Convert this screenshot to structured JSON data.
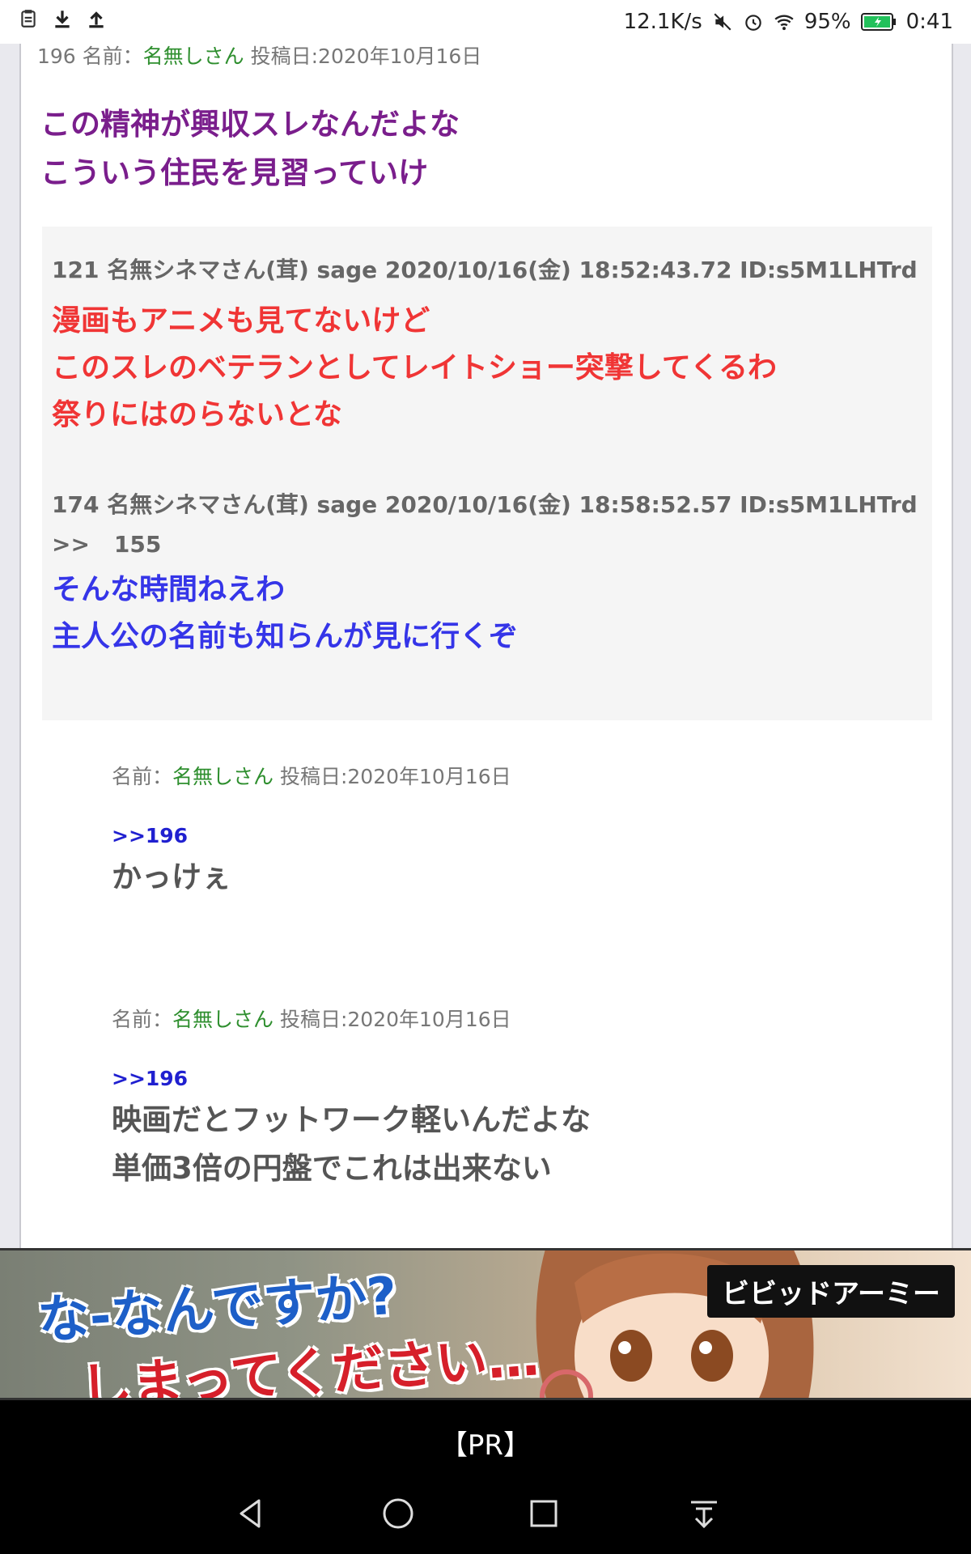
{
  "status_bar": {
    "net_speed": "12.1K/s",
    "battery_percent": "95%",
    "time": "0:41",
    "icons": [
      "clipboard-icon",
      "download-icon",
      "upload-icon",
      "mute-icon",
      "alarm-icon",
      "wifi-icon",
      "battery-icon"
    ]
  },
  "post196": {
    "meta_prefix": "196 名前：",
    "name": "名無しさん",
    "meta_suffix": " 投稿日:2020年10月16日",
    "lines": [
      "この精神が興収スレなんだよな",
      "こういう住民を見習っていけ"
    ]
  },
  "quotes": {
    "q121": {
      "header": "121 名無シネマさん(茸) sage 2020/10/16(金) 18:52:43.72 ID:s5M1LHTrd",
      "lines": [
        "漫画もアニメも見てないけど",
        "このスレのベテランとしてレイトショー突撃してくるわ",
        "祭りにはのらないとな"
      ]
    },
    "q174": {
      "header": "174 名無シネマさん(茸) sage 2020/10/16(金) 18:58:52.57 ID:s5M1LHTrd",
      "anchor_prefix": ">>",
      "anchor_num": "155",
      "lines": [
        "そんな時間ねえわ",
        "主人公の名前も知らんが見に行くぞ"
      ]
    }
  },
  "reply1": {
    "meta_prefix": "名前：",
    "name": "名無しさん",
    "meta_suffix": " 投稿日:2020年10月16日",
    "anchor": ">>196",
    "lines": [
      "かっけぇ"
    ]
  },
  "reply2": {
    "meta_prefix": "名前：",
    "name": "名無しさん",
    "meta_suffix": " 投稿日:2020年10月16日",
    "anchor": ">>196",
    "lines": [
      "映画だとフットワーク軽いんだよな",
      "単価3倍の円盤でこれは出来ない"
    ]
  },
  "ad": {
    "line1": "な-なんですか?",
    "line2": "しまってください…",
    "brand": "ビビッドアーミー"
  },
  "pr_label": "【PR】",
  "nav": {
    "buttons": [
      "back-icon",
      "home-icon",
      "recents-icon",
      "notifications-pull-icon"
    ]
  },
  "colors": {
    "purple": "#7a1e8c",
    "red": "#f03535",
    "blue": "#3535e8",
    "name_green": "#2f8f2f"
  }
}
